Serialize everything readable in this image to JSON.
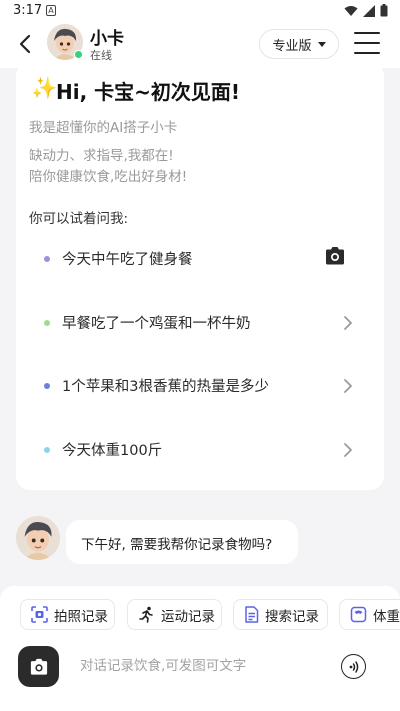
{
  "status_bar": {
    "time": "3:17",
    "notification": "A"
  },
  "header": {
    "name": "小卡",
    "status": "在线",
    "plan_label": "专业版"
  },
  "card": {
    "title": "Hi, 卡宝~初次见面!",
    "subtitle": "我是超懂你的AI搭子小卡",
    "desc_line1": "缺动力、求指导,我都在!",
    "desc_line2": "陪你健康饮食,吃出好身材!",
    "try_label": "你可以试着问我:",
    "suggestions": [
      {
        "text": "今天中午吃了健身餐",
        "dot_color": "#a08ee0",
        "icon": "camera-icon"
      },
      {
        "text": "早餐吃了一个鸡蛋和一杯牛奶",
        "dot_color": "#9fdc8a",
        "icon": "chevron-right-icon"
      },
      {
        "text": "1个苹果和3根香蕉的热量是多少",
        "dot_color": "#6f7fd8",
        "icon": "chevron-right-icon"
      },
      {
        "text": "今天体重100斤",
        "dot_color": "#8fd3ea",
        "icon": "chevron-right-icon"
      }
    ]
  },
  "chat": {
    "bot_message": "下午好, 需要我帮你记录食物吗?"
  },
  "quick_actions": [
    {
      "label": "拍照记录",
      "icon": "scan-icon"
    },
    {
      "label": "运动记录",
      "icon": "running-icon"
    },
    {
      "label": "搜索记录",
      "icon": "document-icon"
    },
    {
      "label": "体重记录",
      "icon": "scale-icon"
    }
  ],
  "composer": {
    "placeholder": "对话记录饮食,可发图可文字"
  },
  "colors": {
    "accent": "#5b63e6",
    "background": "#f4f4f6",
    "online": "#36d27a"
  }
}
